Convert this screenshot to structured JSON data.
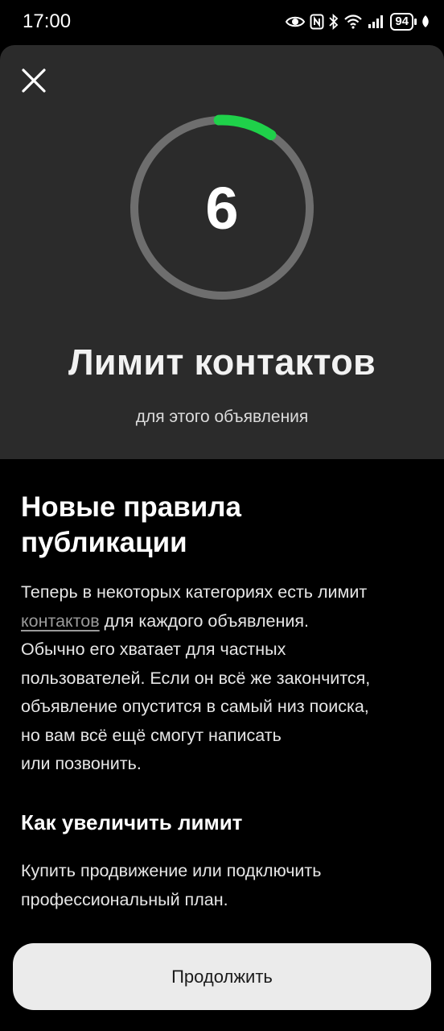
{
  "status_bar": {
    "time": "17:00",
    "battery": "94",
    "icons": [
      "eye-icon",
      "nfc-icon",
      "bluetooth-icon",
      "wifi-icon",
      "signal-icon",
      "battery-icon",
      "leaf-icon"
    ]
  },
  "limit": {
    "count": "6",
    "progress": 0.1,
    "title": "Лимит контактов",
    "subtitle": "для этого объявления"
  },
  "rules": {
    "title_line1": "Новые правила",
    "title_line2": "публикации",
    "line1": "Теперь в некоторых категориях есть лимит",
    "link": "контактов",
    "line2_rest": " для каждого объявления.",
    "line3": "Обычно его хватает для частных",
    "line4": "пользователей. Если он всё же закончится,",
    "line5": "объявление опустится в самый низ поиска,",
    "line6": "но вам всё ещё смогут написать",
    "line7": "или позвонить."
  },
  "increase": {
    "title": "Как увеличить лимит",
    "line1": "Купить продвижение или подключить",
    "line2": "профессиональный план."
  },
  "actions": {
    "continue_label": "Продолжить"
  },
  "colors": {
    "hero_bg": "#2b2b2b",
    "ring_track": "#6e6e6e",
    "ring_progress": "#1fd14a",
    "button_bg": "#ebebeb"
  }
}
